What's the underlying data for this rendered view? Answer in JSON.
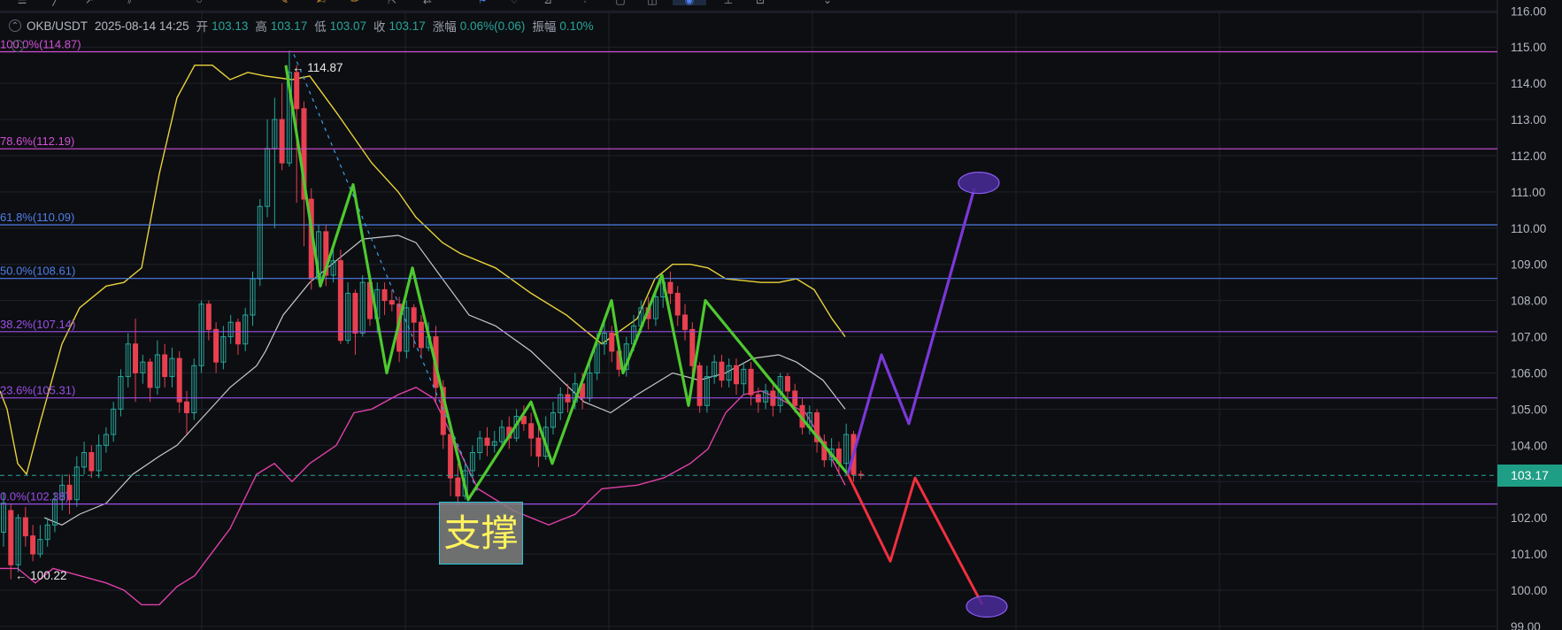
{
  "header": {
    "symbol": "OKB/USDT",
    "datetime": "2025-08-14 14:25",
    "open_label": "开",
    "open": "103.13",
    "high_label": "高",
    "high": "103.17",
    "low_label": "低",
    "low": "103.07",
    "close_label": "收",
    "close": "103.17",
    "change_label": "涨幅",
    "change": "0.06%(0.06)",
    "amplitude_label": "振幅",
    "amplitude": "0.10%"
  },
  "support_label": "支撑",
  "colors": {
    "background": "#0d0e12",
    "grid": "#1f2229",
    "up": "#26a69a",
    "down": "#e84050",
    "bb_upper": "#e8d23a",
    "bb_mid": "#c8c8c8",
    "bb_lower": "#e040a8",
    "zigzag": "#4ec92f",
    "bull_path": "#7a38d8",
    "bear_path": "#f0303f",
    "target": "#4a2a9a",
    "price_tag": "#1f9e86"
  },
  "chart_data": {
    "type": "candlestick",
    "ylim": [
      98.9,
      116.3
    ],
    "y_ticks": [
      "99.00",
      "100.00",
      "101.00",
      "102.00",
      "103.00",
      "104.00",
      "105.00",
      "106.00",
      "107.00",
      "108.00",
      "109.00",
      "110.00",
      "111.00",
      "112.00",
      "113.00",
      "114.00",
      "115.00",
      "116.00"
    ],
    "current_price": "103.17",
    "high_marker": "114.87",
    "low_marker": "100.22",
    "fib_levels": [
      {
        "label": "100.0%(114.87)",
        "value": 114.87,
        "color": "#d24fd8"
      },
      {
        "label": "78.6%(112.19)",
        "value": 112.19,
        "color": "#d24fd8"
      },
      {
        "label": "61.8%(110.09)",
        "value": 110.09,
        "color": "#4f7fe8"
      },
      {
        "label": "50.0%(108.61)",
        "value": 108.61,
        "color": "#4f7fe8"
      },
      {
        "label": "38.2%(107.14)",
        "value": 107.14,
        "color": "#9b4fe8"
      },
      {
        "label": "23.6%(105.31)",
        "value": 105.31,
        "color": "#9b4fe8"
      },
      {
        "label": "0.0%(102.38)",
        "value": 102.38,
        "color": "#9b4fe8"
      }
    ],
    "candles": [
      [
        101.6,
        102.4,
        102.7,
        101.2
      ],
      [
        102.2,
        100.7,
        102.4,
        100.3
      ],
      [
        100.7,
        102.0,
        102.1,
        100.5
      ],
      [
        102.0,
        101.5,
        102.3,
        101.2
      ],
      [
        101.5,
        101.0,
        101.8,
        100.8
      ],
      [
        101.0,
        101.4,
        101.8,
        100.9
      ],
      [
        101.4,
        101.8,
        102.0,
        101.2
      ],
      [
        101.8,
        102.5,
        102.7,
        101.6
      ],
      [
        102.5,
        102.9,
        103.2,
        102.2
      ],
      [
        102.9,
        102.5,
        103.2,
        102.1
      ],
      [
        102.5,
        103.4,
        103.7,
        102.3
      ],
      [
        103.4,
        103.8,
        104.1,
        103.2
      ],
      [
        103.8,
        103.3,
        104.0,
        103.1
      ],
      [
        103.3,
        104.0,
        104.3,
        103.1
      ],
      [
        104.0,
        104.3,
        104.5,
        103.8
      ],
      [
        104.3,
        105.0,
        105.2,
        104.1
      ],
      [
        105.0,
        105.9,
        106.1,
        104.8
      ],
      [
        105.9,
        106.8,
        107.1,
        105.6
      ],
      [
        106.8,
        106.0,
        107.5,
        105.2
      ],
      [
        106.0,
        106.3,
        106.5,
        105.7
      ],
      [
        106.3,
        105.6,
        106.4,
        105.2
      ],
      [
        105.6,
        106.5,
        106.9,
        105.4
      ],
      [
        106.5,
        105.9,
        106.8,
        105.6
      ],
      [
        105.9,
        106.4,
        106.7,
        105.6
      ],
      [
        106.4,
        105.2,
        106.6,
        104.9
      ],
      [
        105.2,
        104.9,
        105.5,
        104.3
      ],
      [
        104.9,
        106.2,
        106.4,
        104.7
      ],
      [
        106.2,
        107.9,
        108.0,
        106.0
      ],
      [
        107.9,
        107.2,
        108.0,
        106.9
      ],
      [
        107.2,
        106.3,
        107.4,
        106.0
      ],
      [
        106.3,
        107.0,
        107.3,
        106.1
      ],
      [
        107.0,
        107.4,
        107.6,
        106.8
      ],
      [
        107.4,
        106.8,
        107.5,
        106.5
      ],
      [
        106.8,
        107.6,
        107.8,
        106.6
      ],
      [
        107.6,
        108.6,
        108.8,
        107.3
      ],
      [
        108.6,
        110.6,
        110.8,
        108.4
      ],
      [
        110.6,
        112.2,
        113.0,
        110.3
      ],
      [
        112.2,
        113.0,
        113.6,
        110.0
      ],
      [
        113.0,
        111.8,
        114.0,
        111.6
      ],
      [
        111.8,
        114.3,
        114.9,
        111.7
      ],
      [
        114.3,
        113.3,
        114.5,
        110.7
      ],
      [
        113.3,
        110.8,
        113.5,
        109.5
      ],
      [
        110.8,
        108.6,
        111.1,
        108.3
      ],
      [
        108.6,
        109.9,
        110.1,
        108.5
      ],
      [
        109.9,
        108.7,
        110.1,
        108.4
      ],
      [
        108.7,
        109.1,
        109.5,
        108.5
      ],
      [
        109.1,
        106.9,
        109.4,
        106.8
      ],
      [
        106.9,
        108.2,
        108.5,
        106.8
      ],
      [
        108.2,
        107.1,
        108.3,
        106.5
      ],
      [
        107.1,
        108.5,
        108.7,
        107.0
      ],
      [
        108.5,
        107.5,
        108.6,
        107.3
      ],
      [
        107.5,
        108.3,
        108.5,
        107.1
      ],
      [
        108.3,
        108.0,
        108.5,
        107.6
      ],
      [
        108.0,
        107.9,
        108.3,
        107.7
      ],
      [
        107.9,
        106.6,
        108.1,
        106.3
      ],
      [
        106.6,
        107.8,
        108.0,
        106.4
      ],
      [
        107.8,
        107.4,
        107.9,
        106.7
      ],
      [
        107.4,
        106.7,
        107.6,
        106.4
      ],
      [
        106.7,
        107.0,
        107.4,
        106.6
      ],
      [
        107.0,
        105.6,
        107.3,
        105.2
      ],
      [
        105.6,
        104.3,
        105.8,
        103.9
      ],
      [
        104.3,
        103.1,
        104.5,
        102.6
      ],
      [
        103.1,
        102.6,
        103.5,
        102.3
      ],
      [
        102.6,
        103.3,
        103.5,
        102.5
      ],
      [
        103.3,
        103.8,
        104.0,
        103.1
      ],
      [
        103.8,
        104.2,
        104.4,
        103.6
      ],
      [
        104.2,
        104.0,
        104.5,
        103.7
      ],
      [
        104.0,
        104.1,
        104.4,
        103.8
      ],
      [
        104.1,
        104.5,
        104.7,
        103.9
      ],
      [
        104.5,
        104.2,
        104.8,
        103.9
      ],
      [
        104.2,
        104.8,
        105.0,
        104.1
      ],
      [
        104.8,
        104.6,
        105.1,
        104.4
      ],
      [
        104.6,
        104.2,
        104.9,
        103.7
      ],
      [
        104.2,
        103.7,
        104.5,
        103.4
      ],
      [
        103.7,
        104.5,
        104.8,
        103.6
      ],
      [
        104.5,
        104.9,
        105.2,
        104.3
      ],
      [
        104.9,
        105.4,
        105.6,
        104.7
      ],
      [
        105.4,
        105.2,
        105.7,
        104.9
      ],
      [
        105.2,
        105.7,
        106.0,
        105.0
      ],
      [
        105.7,
        105.3,
        106.0,
        105.0
      ],
      [
        105.3,
        106.0,
        106.3,
        105.2
      ],
      [
        106.0,
        106.8,
        107.1,
        105.8
      ],
      [
        106.8,
        107.1,
        107.5,
        106.5
      ],
      [
        107.1,
        106.6,
        107.3,
        106.3
      ],
      [
        106.6,
        106.1,
        106.9,
        105.9
      ],
      [
        106.1,
        106.8,
        107.0,
        105.9
      ],
      [
        106.8,
        107.3,
        107.6,
        106.6
      ],
      [
        107.3,
        107.8,
        108.0,
        107.1
      ],
      [
        107.8,
        107.5,
        108.1,
        107.2
      ],
      [
        107.5,
        108.1,
        108.3,
        107.3
      ],
      [
        108.1,
        108.5,
        108.7,
        107.8
      ],
      [
        108.5,
        108.2,
        108.8,
        107.9
      ],
      [
        108.2,
        107.6,
        108.4,
        107.3
      ],
      [
        107.6,
        107.2,
        107.9,
        106.9
      ],
      [
        107.2,
        106.2,
        107.4,
        105.8
      ],
      [
        106.2,
        105.1,
        106.3,
        104.9
      ],
      [
        105.1,
        105.9,
        106.2,
        104.9
      ],
      [
        105.9,
        106.3,
        106.5,
        105.7
      ],
      [
        106.3,
        105.8,
        106.5,
        105.6
      ],
      [
        105.8,
        106.2,
        106.4,
        105.6
      ],
      [
        106.2,
        105.7,
        106.4,
        105.4
      ],
      [
        105.7,
        106.1,
        106.3,
        105.4
      ],
      [
        106.1,
        105.4,
        106.3,
        105.1
      ],
      [
        105.4,
        105.2,
        105.6,
        104.9
      ],
      [
        105.2,
        105.5,
        105.7,
        105.0
      ],
      [
        105.5,
        105.1,
        105.7,
        104.8
      ],
      [
        105.1,
        105.9,
        106.0,
        104.9
      ],
      [
        105.9,
        105.5,
        106.0,
        105.2
      ],
      [
        105.5,
        105.1,
        105.7,
        104.9
      ],
      [
        105.1,
        104.5,
        105.3,
        104.3
      ],
      [
        104.5,
        104.9,
        105.1,
        104.3
      ],
      [
        104.9,
        104.1,
        105.0,
        103.8
      ],
      [
        104.1,
        103.6,
        104.3,
        103.4
      ],
      [
        103.6,
        103.9,
        104.2,
        103.4
      ],
      [
        103.9,
        103.5,
        104.1,
        103.2
      ],
      [
        103.5,
        104.3,
        104.6,
        103.3
      ],
      [
        104.3,
        103.2,
        104.4,
        103.0
      ],
      [
        103.2,
        103.17,
        103.3,
        103.07
      ]
    ],
    "bb_upper": [
      [
        0,
        105.5
      ],
      [
        8,
        105.0
      ],
      [
        20,
        103.5
      ],
      [
        30,
        103.2
      ],
      [
        45,
        104.6
      ],
      [
        70,
        106.8
      ],
      [
        90,
        107.8
      ],
      [
        120,
        108.4
      ],
      [
        140,
        108.5
      ],
      [
        160,
        108.9
      ],
      [
        180,
        111.5
      ],
      [
        200,
        113.6
      ],
      [
        220,
        114.5
      ],
      [
        240,
        114.5
      ],
      [
        260,
        114.1
      ],
      [
        280,
        114.3
      ],
      [
        300,
        114.2
      ],
      [
        330,
        114.1
      ],
      [
        350,
        114.2
      ],
      [
        380,
        113.2
      ],
      [
        420,
        111.8
      ],
      [
        450,
        111.0
      ],
      [
        470,
        110.3
      ],
      [
        500,
        109.6
      ],
      [
        520,
        109.3
      ],
      [
        560,
        108.9
      ],
      [
        600,
        108.2
      ],
      [
        640,
        107.6
      ],
      [
        660,
        107.2
      ],
      [
        680,
        106.8
      ],
      [
        720,
        107.5
      ],
      [
        740,
        108.6
      ],
      [
        760,
        109.0
      ],
      [
        780,
        109.0
      ],
      [
        800,
        108.9
      ],
      [
        820,
        108.6
      ],
      [
        860,
        108.5
      ],
      [
        880,
        108.5
      ],
      [
        900,
        108.6
      ],
      [
        920,
        108.3
      ],
      [
        940,
        107.5
      ],
      [
        955,
        107.0
      ]
    ],
    "bb_mid": [
      [
        50,
        102.0
      ],
      [
        70,
        101.8
      ],
      [
        90,
        102.1
      ],
      [
        120,
        102.4
      ],
      [
        150,
        103.2
      ],
      [
        180,
        103.7
      ],
      [
        200,
        104.0
      ],
      [
        230,
        104.8
      ],
      [
        260,
        105.6
      ],
      [
        290,
        106.2
      ],
      [
        300,
        106.6
      ],
      [
        320,
        107.6
      ],
      [
        350,
        108.5
      ],
      [
        380,
        109.1
      ],
      [
        410,
        109.7
      ],
      [
        450,
        109.8
      ],
      [
        470,
        109.6
      ],
      [
        500,
        108.6
      ],
      [
        530,
        107.6
      ],
      [
        560,
        107.3
      ],
      [
        600,
        106.6
      ],
      [
        630,
        105.9
      ],
      [
        660,
        105.2
      ],
      [
        690,
        104.9
      ],
      [
        720,
        105.4
      ],
      [
        760,
        106.0
      ],
      [
        790,
        105.8
      ],
      [
        820,
        106.0
      ],
      [
        850,
        106.4
      ],
      [
        880,
        106.5
      ],
      [
        900,
        106.3
      ],
      [
        930,
        105.8
      ],
      [
        955,
        105.0
      ]
    ],
    "bb_lower": [
      [
        0,
        100.6
      ],
      [
        20,
        100.6
      ],
      [
        40,
        100.2
      ],
      [
        60,
        100.6
      ],
      [
        90,
        100.4
      ],
      [
        120,
        100.2
      ],
      [
        140,
        100.0
      ],
      [
        160,
        99.6
      ],
      [
        180,
        99.6
      ],
      [
        200,
        100.1
      ],
      [
        220,
        100.4
      ],
      [
        260,
        101.7
      ],
      [
        290,
        103.2
      ],
      [
        310,
        103.5
      ],
      [
        330,
        103.0
      ],
      [
        350,
        103.5
      ],
      [
        380,
        104.0
      ],
      [
        400,
        104.9
      ],
      [
        420,
        105.0
      ],
      [
        450,
        105.4
      ],
      [
        470,
        105.6
      ],
      [
        490,
        105.3
      ],
      [
        510,
        104.3
      ],
      [
        540,
        102.8
      ],
      [
        580,
        102.2
      ],
      [
        620,
        101.8
      ],
      [
        650,
        102.1
      ],
      [
        680,
        102.8
      ],
      [
        720,
        102.9
      ],
      [
        750,
        103.1
      ],
      [
        780,
        103.5
      ],
      [
        800,
        103.9
      ],
      [
        820,
        104.9
      ],
      [
        840,
        105.4
      ],
      [
        860,
        105.5
      ],
      [
        880,
        105.3
      ],
      [
        910,
        104.9
      ],
      [
        930,
        104.1
      ],
      [
        955,
        102.9
      ]
    ],
    "zigzag": [
      [
        323,
        114.5
      ],
      [
        362,
        108.4
      ],
      [
        399,
        111.2
      ],
      [
        437,
        106.0
      ],
      [
        466,
        108.9
      ],
      [
        529,
        102.5
      ],
      [
        600,
        105.2
      ],
      [
        624,
        103.5
      ],
      [
        691,
        108.0
      ],
      [
        704,
        106.0
      ],
      [
        748,
        108.7
      ],
      [
        778,
        105.1
      ],
      [
        797,
        108.0
      ],
      [
        958,
        103.2
      ]
    ],
    "bullish_projection": [
      [
        958,
        103.2
      ],
      [
        996,
        106.5
      ],
      [
        1027,
        104.6
      ],
      [
        1101,
        111.1
      ]
    ],
    "bearish_projection": [
      [
        958,
        103.2
      ],
      [
        1006,
        100.8
      ],
      [
        1034,
        103.1
      ],
      [
        1110,
        99.6
      ]
    ],
    "targets": [
      [
        1106,
        111.25
      ],
      [
        1115,
        99.55
      ]
    ]
  }
}
